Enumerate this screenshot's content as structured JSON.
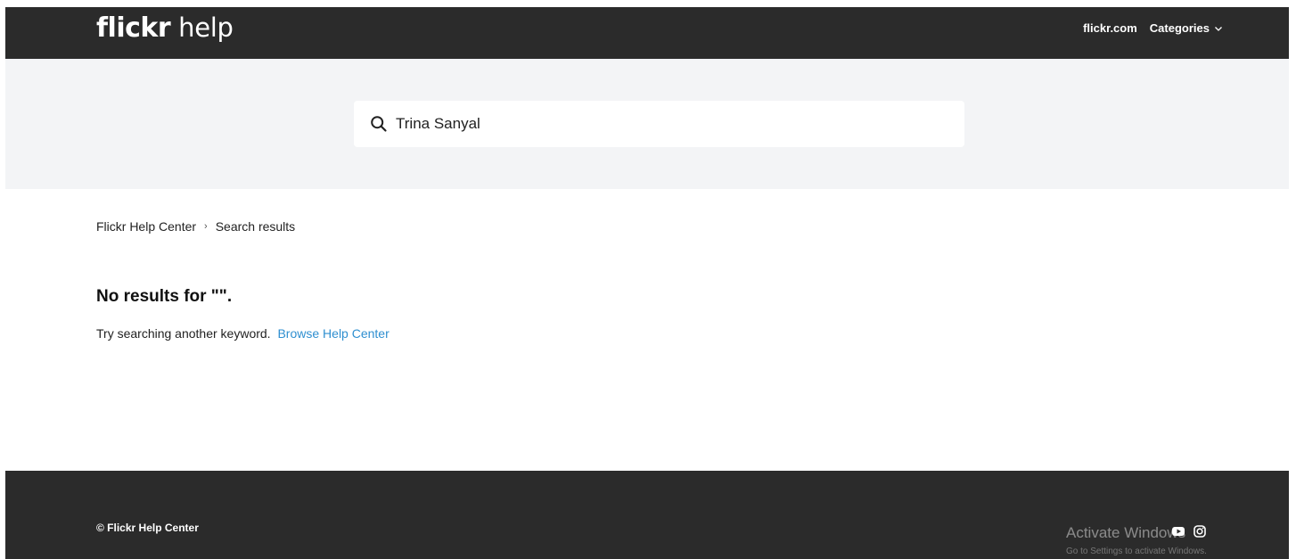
{
  "header": {
    "logo_brand": "flickr",
    "logo_suffix": "help",
    "nav_site_link": "flickr.com",
    "nav_categories": "Categories",
    "accent_color": "#2b2b2b"
  },
  "search": {
    "value": "Trina Sanyal",
    "icon": "search-icon"
  },
  "breadcrumb": {
    "items": [
      "Flickr Help Center",
      "Search results"
    ],
    "separator": "›"
  },
  "results": {
    "title": "No results for \"\".",
    "message": "Try searching another keyword.",
    "link_label": "Browse Help Center",
    "link_color": "#2f8fd0"
  },
  "footer": {
    "copyright": "© Flickr Help Center",
    "social_icons": [
      "youtube-icon",
      "instagram-icon"
    ]
  },
  "os_overlay": {
    "title": "Activate Windows",
    "subtitle": "Go to Settings to activate Windows."
  }
}
